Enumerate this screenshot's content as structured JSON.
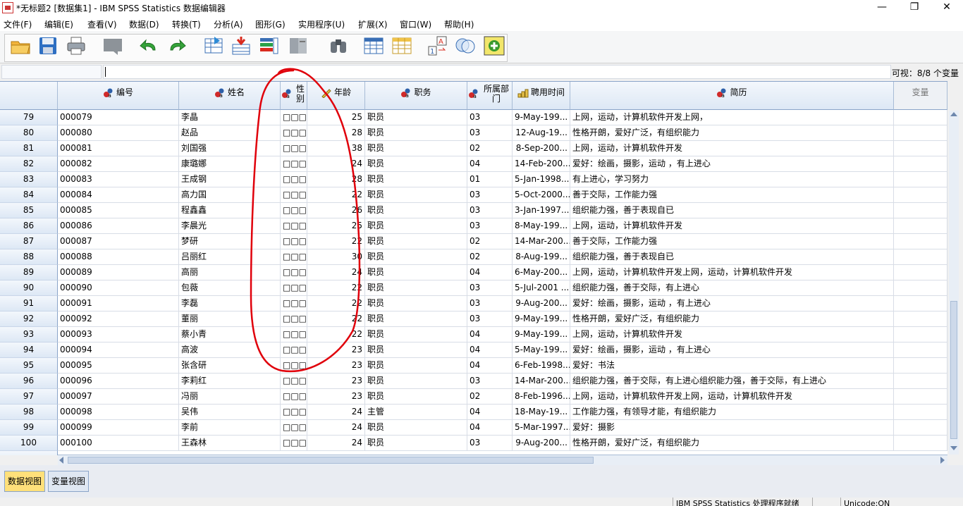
{
  "window": {
    "title": "*无标题2 [数据集1] - IBM SPSS Statistics 数据编辑器",
    "controls": [
      "—",
      "❐",
      "✕"
    ]
  },
  "menu": [
    "文件(F)",
    "编辑(E)",
    "查看(V)",
    "数据(D)",
    "转换(T)",
    "分析(A)",
    "图形(G)",
    "实用程序(U)",
    "扩展(X)",
    "窗口(W)",
    "帮助(H)"
  ],
  "toolbar": {
    "icons": [
      "open-folder-icon",
      "save-icon",
      "print-icon",
      "dialog-recall-icon",
      "undo-icon",
      "redo-icon",
      "go-to-case-icon",
      "go-to-variable-icon",
      "variables-icon",
      "run-descriptives-icon",
      "find-icon",
      "insert-cases-icon",
      "insert-variable-icon",
      "split-file-icon",
      "value-labels-icon",
      "use-variable-sets-icon",
      "spelling-icon"
    ]
  },
  "editbar": {
    "cell_ref": "",
    "cell_value": "",
    "visible_count": "可视：8/8 个变量"
  },
  "grid": {
    "columns": [
      {
        "label": "编号",
        "measure": "nominal"
      },
      {
        "label": "姓名",
        "measure": "nominal"
      },
      {
        "label": "性别",
        "measure": "nominal"
      },
      {
        "label": "年龄",
        "measure": "scale"
      },
      {
        "label": "职务",
        "measure": "nominal"
      },
      {
        "label": "所属部门",
        "measure": "nominal"
      },
      {
        "label": "聘用时间",
        "measure": "ordinal"
      },
      {
        "label": "简历",
        "measure": "nominal"
      },
      {
        "label": "变量",
        "measure": "empty"
      }
    ],
    "rows": [
      {
        "n": "79",
        "id": "000079",
        "name": "李晶",
        "sex": "□□□",
        "age": "25",
        "job": "职员",
        "dept": "03",
        "date": "9-May-199...",
        "resume": "上网，运动，计算机软件开发上网，"
      },
      {
        "n": "80",
        "id": "000080",
        "name": "赵品",
        "sex": "□□□",
        "age": "28",
        "job": "职员",
        "dept": "03",
        "date": "12-Aug-19...",
        "resume": "性格开朗，爱好广泛，有组织能力"
      },
      {
        "n": "81",
        "id": "000081",
        "name": "刘国强",
        "sex": "□□□",
        "age": "38",
        "job": "职员",
        "dept": "02",
        "date": "8-Sep-200...",
        "resume": "上网，运动，计算机软件开发"
      },
      {
        "n": "82",
        "id": "000082",
        "name": "康璐娜",
        "sex": "□□□",
        "age": "24",
        "job": "职员",
        "dept": "04",
        "date": "14-Feb-200...",
        "resume": "爱好：绘画，摄影，运动 ，有上进心"
      },
      {
        "n": "83",
        "id": "000083",
        "name": "王成钢",
        "sex": "□□□",
        "age": "28",
        "job": "职员",
        "dept": "01",
        "date": "5-Jan-1998...",
        "resume": "有上进心，学习努力"
      },
      {
        "n": "84",
        "id": "000084",
        "name": "高力国",
        "sex": "□□□",
        "age": "22",
        "job": "职员",
        "dept": "03",
        "date": "5-Oct-2000...",
        "resume": "善于交际，工作能力强"
      },
      {
        "n": "85",
        "id": "000085",
        "name": "程鑫鑫",
        "sex": "□□□",
        "age": "26",
        "job": "职员",
        "dept": "03",
        "date": "3-Jan-1997...",
        "resume": "组织能力强，善于表现自已"
      },
      {
        "n": "86",
        "id": "000086",
        "name": "李晨光",
        "sex": "□□□",
        "age": "25",
        "job": "职员",
        "dept": "03",
        "date": "8-May-199...",
        "resume": "上网，运动，计算机软件开发"
      },
      {
        "n": "87",
        "id": "000087",
        "name": "梦研",
        "sex": "□□□",
        "age": "22",
        "job": "职员",
        "dept": "02",
        "date": "14-Mar-200...",
        "resume": "善于交际，工作能力强"
      },
      {
        "n": "88",
        "id": "000088",
        "name": "吕丽红",
        "sex": "□□□",
        "age": "30",
        "job": "职员",
        "dept": "02",
        "date": "8-Aug-199...",
        "resume": "组织能力强，善于表现自已"
      },
      {
        "n": "89",
        "id": "000089",
        "name": "高丽",
        "sex": "□□□",
        "age": "24",
        "job": "职员",
        "dept": "04",
        "date": "6-May-200...",
        "resume": "上网，运动，计算机软件开发上网，运动，计算机软件开发"
      },
      {
        "n": "90",
        "id": "000090",
        "name": "包薇",
        "sex": "□□□",
        "age": "22",
        "job": "职员",
        "dept": "03",
        "date": "5-Jul-2001 ...",
        "resume": "组织能力强，善于交际，有上进心"
      },
      {
        "n": "91",
        "id": "000091",
        "name": "李磊",
        "sex": "□□□",
        "age": "22",
        "job": "职员",
        "dept": "03",
        "date": "9-Aug-200...",
        "resume": "爱好：绘画，摄影，运动 ，有上进心"
      },
      {
        "n": "92",
        "id": "000092",
        "name": "董丽",
        "sex": "□□□",
        "age": "22",
        "job": "职员",
        "dept": "03",
        "date": "9-May-199...",
        "resume": "性格开朗，爱好广泛，有组织能力"
      },
      {
        "n": "93",
        "id": "000093",
        "name": "蔡小青",
        "sex": "□□□",
        "age": "22",
        "job": "职员",
        "dept": "04",
        "date": "9-May-199...",
        "resume": "上网，运动，计算机软件开发"
      },
      {
        "n": "94",
        "id": "000094",
        "name": "高波",
        "sex": "□□□",
        "age": "23",
        "job": "职员",
        "dept": "04",
        "date": "5-May-199...",
        "resume": "爱好：绘画，摄影，运动 ，有上进心"
      },
      {
        "n": "95",
        "id": "000095",
        "name": "张含研",
        "sex": "□□□",
        "age": "23",
        "job": "职员",
        "dept": "04",
        "date": "6-Feb-1998...",
        "resume": "爱好：书法"
      },
      {
        "n": "96",
        "id": "000096",
        "name": "李莉红",
        "sex": "□□□",
        "age": "23",
        "job": "职员",
        "dept": "03",
        "date": "14-Mar-200...",
        "resume": "组织能力强，善于交际，有上进心组织能力强，善于交际，有上进心"
      },
      {
        "n": "97",
        "id": "000097",
        "name": "冯丽",
        "sex": "□□□",
        "age": "23",
        "job": "职员",
        "dept": "02",
        "date": "8-Feb-1996...",
        "resume": "上网，运动，计算机软件开发上网，运动，计算机软件开发"
      },
      {
        "n": "98",
        "id": "000098",
        "name": "吴伟",
        "sex": "□□□",
        "age": "24",
        "job": "主管",
        "dept": "04",
        "date": "18-May-19...",
        "resume": "工作能力强，有领导才能，有组织能力"
      },
      {
        "n": "99",
        "id": "000099",
        "name": "李前",
        "sex": "□□□",
        "age": "24",
        "job": "职员",
        "dept": "04",
        "date": "5-Mar-1997...",
        "resume": "爱好：摄影"
      },
      {
        "n": "100",
        "id": "000100",
        "name": "王森林",
        "sex": "□□□",
        "age": "24",
        "job": "职员",
        "dept": "03",
        "date": "9-Aug-200...",
        "resume": "性格开朗，爱好广泛，有组织能力"
      }
    ]
  },
  "tabs": {
    "data_view": "数据视图",
    "variable_view": "变量视图",
    "active": "data_view"
  },
  "status": {
    "processor": "IBM SPSS Statistics 处理程序就绪",
    "unicode": "Unicode:ON"
  },
  "colors": {
    "header_bg": "#dde8f5",
    "grid_line": "#d8dde6",
    "annotation": "#e0000b",
    "active_tab": "#ffe07a"
  }
}
